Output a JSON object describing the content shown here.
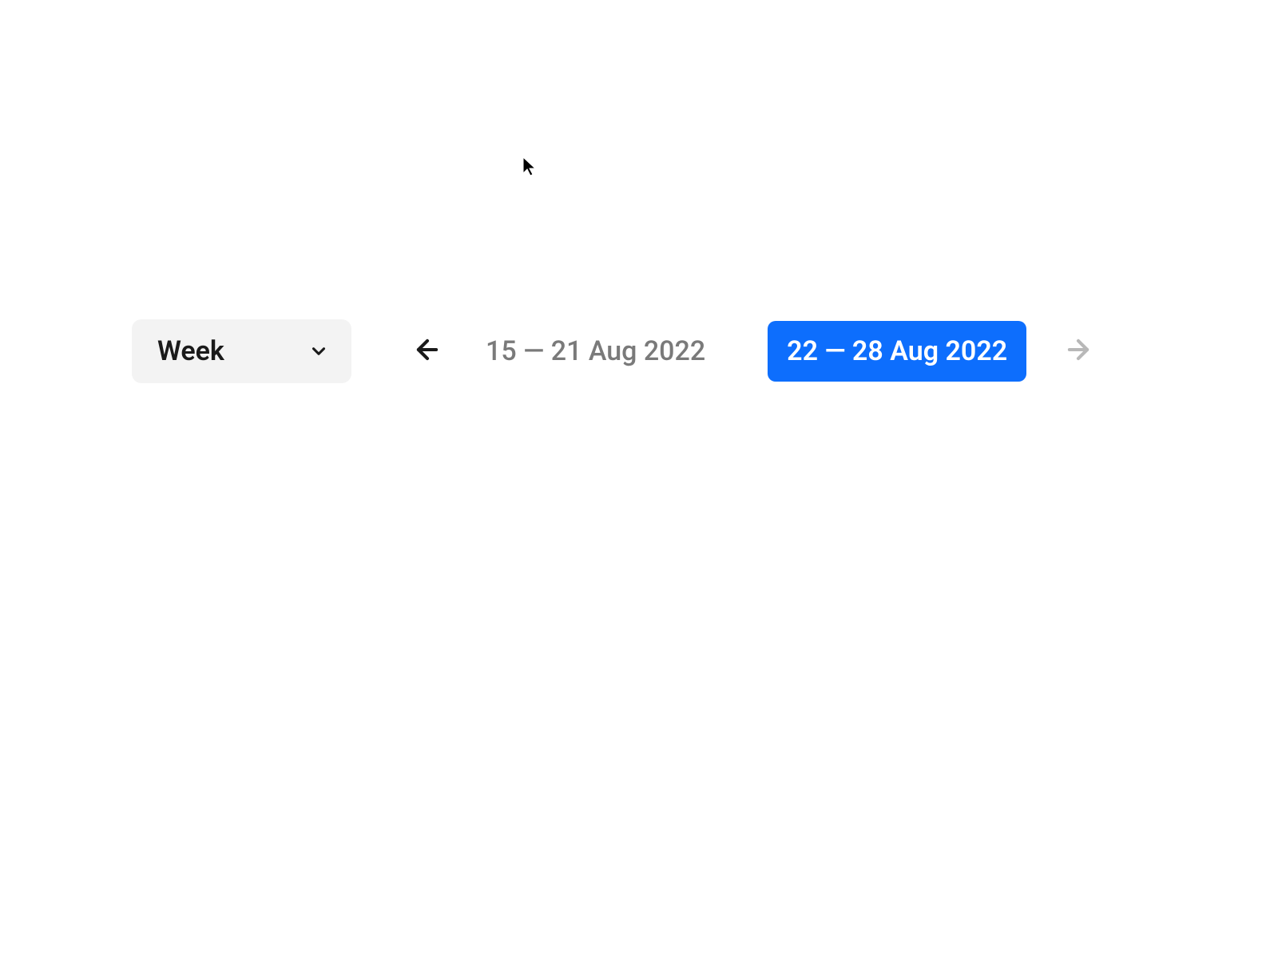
{
  "period_selector": {
    "label": "Week"
  },
  "date_ranges": {
    "previous": "15 — 21 Aug 2022",
    "current": "22 — 28 Aug 2022"
  },
  "colors": {
    "accent": "#0d6efd",
    "muted_text": "#7a7a7a",
    "select_bg": "#f3f3f3",
    "disabled_icon": "#b8b8b8"
  }
}
